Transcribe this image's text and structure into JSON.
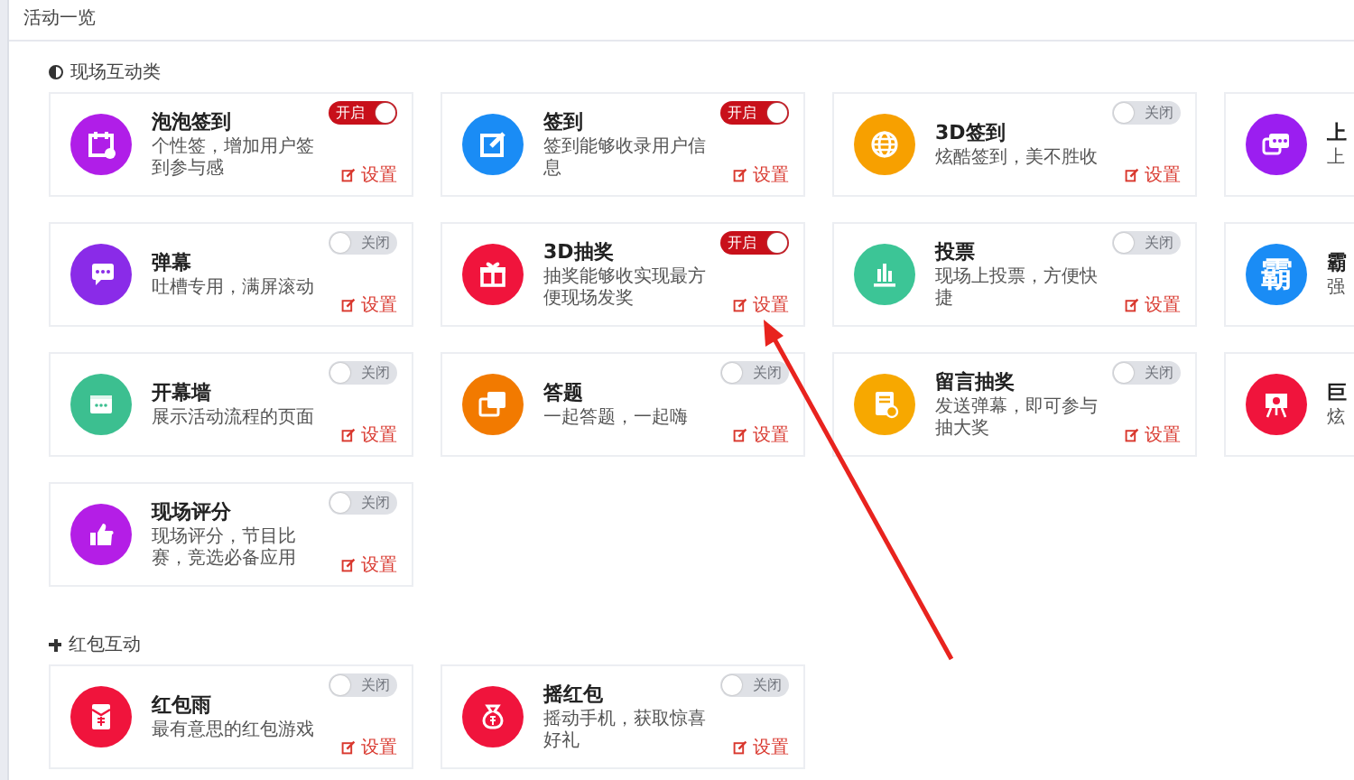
{
  "panel": {
    "title": "活动一览"
  },
  "sections": [
    {
      "title": "现场互动类",
      "items": [
        {
          "title": "泡泡签到",
          "desc": "个性签，增加用户签到参与感",
          "toggle": {
            "label": "开启",
            "on": true
          },
          "settings": "设置"
        },
        {
          "title": "签到",
          "desc": "签到能够收录用户信息",
          "toggle": {
            "label": "开启",
            "on": true
          },
          "settings": "设置"
        },
        {
          "title": "3D签到",
          "desc": "炫酷签到，美不胜收",
          "toggle": {
            "label": "关闭",
            "on": false
          },
          "settings": "设置"
        },
        {
          "title": "上",
          "desc": "上"
        },
        {
          "title": "弹幕",
          "desc": "吐槽专用，满屏滚动",
          "toggle": {
            "label": "关闭",
            "on": false
          },
          "settings": "设置"
        },
        {
          "title": "3D抽奖",
          "desc": "抽奖能够收实现最方便现场发奖",
          "toggle": {
            "label": "开启",
            "on": true
          },
          "settings": "设置"
        },
        {
          "title": "投票",
          "desc": "现场上投票，方便快捷",
          "toggle": {
            "label": "关闭",
            "on": false
          },
          "settings": "设置"
        },
        {
          "title": "霸",
          "desc": "强",
          "icon_text": "霸"
        },
        {
          "title": "开幕墙",
          "desc": "展示活动流程的页面",
          "toggle": {
            "label": "关闭",
            "on": false
          },
          "settings": "设置"
        },
        {
          "title": "答题",
          "desc": "一起答题，一起嗨",
          "toggle": {
            "label": "关闭",
            "on": false
          },
          "settings": "设置"
        },
        {
          "title": "留言抽奖",
          "desc": "发送弹幕，即可参与抽大奖",
          "toggle": {
            "label": "关闭",
            "on": false
          },
          "settings": "设置"
        },
        {
          "title": "巨",
          "desc": "炫"
        },
        {
          "title": "现场评分",
          "desc": "现场评分，节目比赛，竞选必备应用",
          "toggle": {
            "label": "关闭",
            "on": false
          },
          "settings": "设置"
        }
      ]
    },
    {
      "title": "红包互动",
      "items": [
        {
          "title": "红包雨",
          "desc": "最有意思的红包游戏",
          "toggle": {
            "label": "关闭",
            "on": false
          },
          "settings": "设置"
        },
        {
          "title": "摇红包",
          "desc": "摇动手机，获取惊喜好礼",
          "toggle": {
            "label": "关闭",
            "on": false
          },
          "settings": "设置"
        }
      ]
    }
  ]
}
